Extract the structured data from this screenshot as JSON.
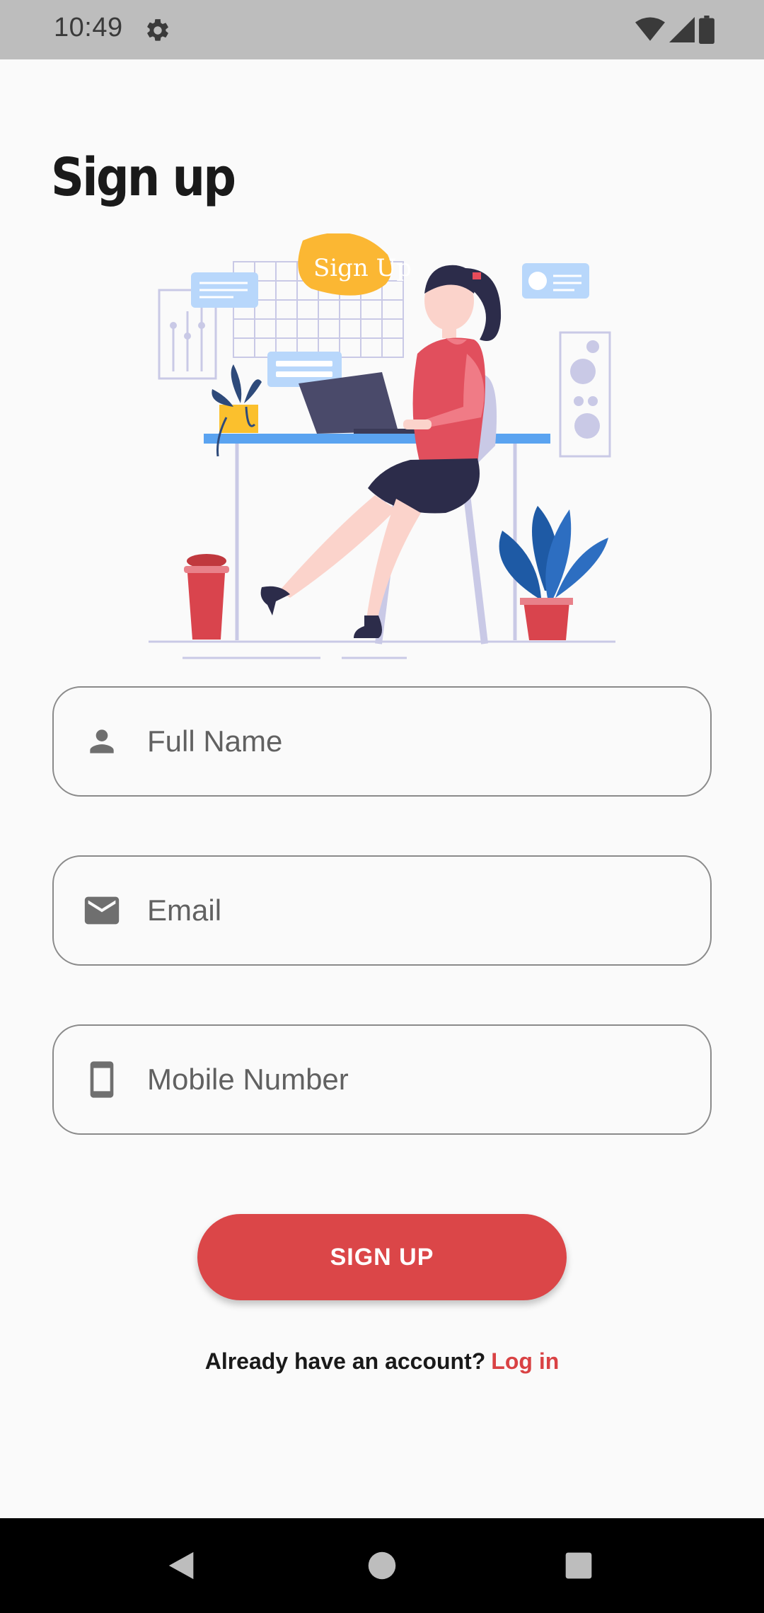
{
  "status_bar": {
    "time": "10:49",
    "settings_icon": "gear-icon",
    "wifi_icon": "wifi-icon",
    "signal_icon": "cell-signal-icon",
    "battery_icon": "battery-icon"
  },
  "page": {
    "title": "Sign up"
  },
  "illustration": {
    "bubble_text": "Sign Up"
  },
  "form": {
    "full_name": {
      "placeholder": "Full Name",
      "icon": "person-icon"
    },
    "email": {
      "placeholder": "Email",
      "icon": "mail-icon"
    },
    "mobile": {
      "placeholder": "Mobile Number",
      "icon": "phone-icon"
    }
  },
  "signup_button": {
    "label": "SIGN UP"
  },
  "footer": {
    "prompt": "Already have an account?",
    "login_label": "Log in"
  },
  "colors": {
    "accent": "#db4648",
    "status_bar": "#bdbdbd",
    "background": "#fafafa"
  },
  "nav_bar": {
    "back_icon": "back-triangle-icon",
    "home_icon": "home-circle-icon",
    "recents_icon": "recents-square-icon"
  }
}
